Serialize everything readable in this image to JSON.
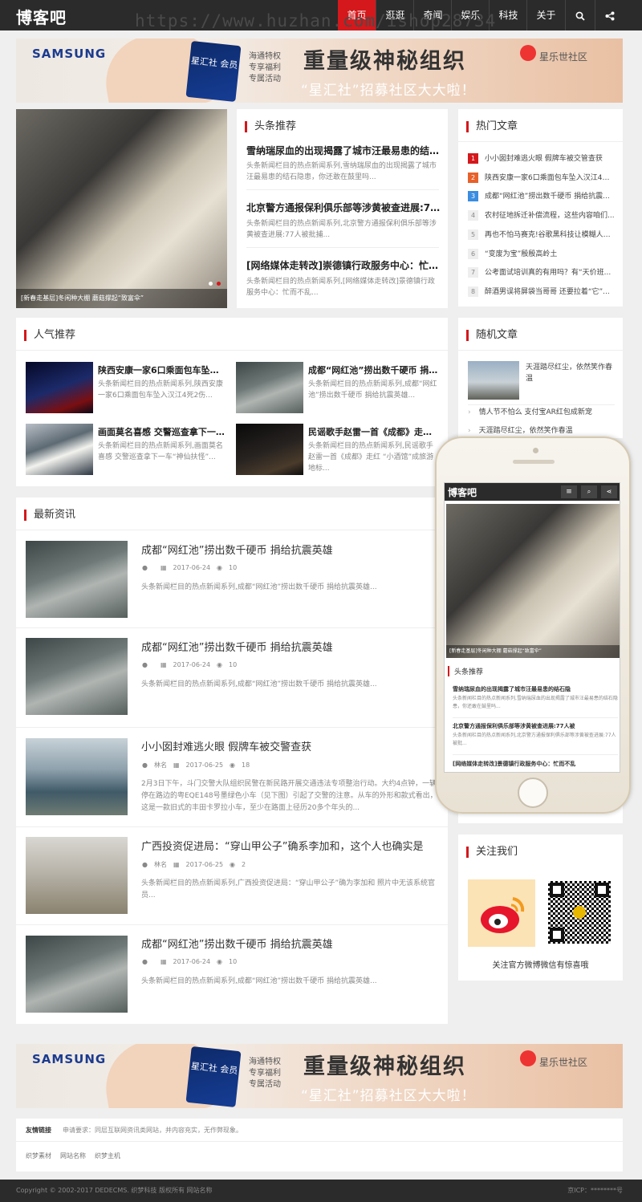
{
  "site": {
    "logo": "博客吧"
  },
  "nav": {
    "items": [
      "首页",
      "逛逛",
      "奇闻",
      "娱乐",
      "科技",
      "关于"
    ],
    "active": "首页"
  },
  "watermark": "https://www.huzhan.com/ishop28734",
  "banner": {
    "brand": "SAMSUNG",
    "card": "星汇社 会员",
    "perks": [
      "海通特权",
      "专享福利",
      "专属活动"
    ],
    "headline": "重量级神秘组织",
    "subline": "“星汇社”招募社区大大啦！",
    "club": "星乐世社区"
  },
  "featured": {
    "caption": "[新春走基层]冬闲种大棚 蘑菇撑起“致富伞”"
  },
  "headlines": {
    "title": "头条推荐",
    "items": [
      {
        "title": "雪纳瑞尿血的出现揭露了城市汪最易患的结石...",
        "desc": "头条新闻栏目的热点新闻系列,雪纳瑞尿血的出现揭露了城市汪最易患的结石隐患，你还敢在鼓里吗..."
      },
      {
        "title": "北京警方通报保利俱乐部等涉黄被查进展:77...",
        "desc": "头条新闻栏目的热点新闻系列,北京警方通报保利俱乐部等涉黄被查进展:77人被批捕..."
      },
      {
        "title": "[网络媒体走转改]崇德镇行政服务中心：忙而...",
        "desc": "头条新闻栏目的热点新闻系列,[网络媒体走转改]景德镇行政服务中心：忙而不乱..."
      }
    ]
  },
  "hot": {
    "title": "热门文章",
    "items": [
      "小小囡封难逃火眼 假牌车被交管查获",
      "陕西安康一家6口乘面包车坠入汉江4死...",
      "成都“网红池”捞出数千硬币 捐给抗震...",
      "农村征地拆迁补偿流程，这些内容咱们...",
      "再也不怕马赛克!谷歌黑科技让模糊人脸...",
      "“变废为宝”殷殷高岭土",
      "公考面试培训真的有用吗？有“天价班...",
      "醉酒男误将屏袋当哥哥 还要拉着“它”..."
    ]
  },
  "popular": {
    "title": "人气推荐",
    "items": [
      {
        "title": "陕西安康一家6口乘面包车坠入汉...",
        "desc": "头条新闻栏目的热点新闻系列,陕西安康一家6口乘面包车坠入汉江4死2伤..."
      },
      {
        "title": "成都“网红池”捞出数千硬币 捐给...",
        "desc": "头条新闻栏目的热点新闻系列,成都“网红池”捞出数千硬币 捐给抗震英雄..."
      },
      {
        "title": "画面莫名喜感 交警巡查拿下一车“...",
        "desc": "头条新闻栏目的热点新闻系列,画面莫名喜感 交警巡查拿下一车“神仙扶怪”..."
      },
      {
        "title": "民谣歌手赵雷一首《成都》走红 “...",
        "desc": "头条新闻栏目的热点新闻系列,民谣歌手赵雷一首《成都》走红 “小酒馆”成旅游地标..."
      }
    ]
  },
  "random": {
    "title": "随机文章",
    "top": "天涯踏尽红尘，依然笑作春温",
    "items": [
      "情人节不怕么 支付宝AR红包成新宠",
      "天涯踏尽红尘，依然笑作春温"
    ]
  },
  "latest": {
    "title": "最新资讯",
    "items": [
      {
        "title": "成都“网红池”捞出数千硬币 捐给抗震英雄",
        "author": "",
        "date": "2017-06-24",
        "views": "10",
        "desc": "头条新闻栏目的热点新闻系列,成都“网红池”捞出数千硬币 捐给抗震英雄..."
      },
      {
        "title": "成都“网红池”捞出数千硬币 捐给抗震英雄",
        "author": "",
        "date": "2017-06-24",
        "views": "10",
        "desc": "头条新闻栏目的热点新闻系列,成都“网红池”捞出数千硬币 捐给抗震英雄..."
      },
      {
        "title": "小小囡封难逃火眼 假牌车被交警查获",
        "author": "林名",
        "date": "2017-06-25",
        "views": "18",
        "desc": "2月3日下午，斗门交警大队组织民警在新民路开展交通违法专项整治行动。大约4点钟，一辆停在路边的粤EQE148号墨绿色小车（见下图）引起了交警的注意。从车的外形和款式看出，这是一款旧式的丰田卡罗拉小车，至少在路面上径历20多个年头的..."
      },
      {
        "title": "广西投资促进局：“穿山甲公子”确系李加和，这个人也确实是",
        "author": "林名",
        "date": "2017-06-25",
        "views": "2",
        "desc": "头条新闻栏目的热点新闻系列,广西投资促进局：“穿山甲公子”确为李加和 照片中无该系统官员..."
      },
      {
        "title": "成都“网红池”捞出数千硬币 捐给抗震英雄",
        "author": "",
        "date": "2017-06-24",
        "views": "10",
        "desc": "头条新闻栏目的热点新闻系列,成都“网红池”捞出数千硬币 捐给抗震英雄..."
      }
    ]
  },
  "follow": {
    "title": "关注我们",
    "caption": "关注官方微博微信有惊喜哦"
  },
  "links": {
    "label": "友情链接",
    "note": "申请要求：同层互联网资讯类网站，并内容充实，无作弊现象。",
    "items": [
      "织梦素材",
      "网站名称",
      "织梦主机"
    ]
  },
  "footer": {
    "copyright": "Copyright © 2002-2017 DEDECMS. 织梦科技 版权所有 网站名称",
    "icp": "京ICP：********号"
  },
  "phone": {
    "logo": "博客吧",
    "caption": "[新春走基层]冬闲种大棚 蘑菇撑起“致富伞”",
    "section": "头条推荐",
    "items": [
      {
        "title": "雪纳瑞尿血的出现揭露了城市汪最易患的结石隐",
        "desc": "头条新闻栏目的热点新闻系列,雪纳瑞尿血的出现揭露了城市汪最易患的结石隐患，你还敢在鼓里吗..."
      },
      {
        "title": "北京警方通报保利俱乐部等涉黄被查进展:77人被",
        "desc": "头条新闻栏目的热点新闻系列,北京警方通报保利俱乐部等涉黄被查进展:77人被批..."
      },
      {
        "title": "[网络媒体走转改]景德镇行政服务中心：忙而不乱",
        "desc": ""
      }
    ]
  },
  "icons": {
    "search": "search-icon",
    "share": "share-icon",
    "menu": "menu-icon",
    "user": "user-icon",
    "calendar": "calendar-icon",
    "eye": "eye-icon",
    "weibo": "weibo-icon",
    "qr": "qr-code"
  },
  "colors": {
    "accent": "#d4181b",
    "nav": "#2b2b2b"
  }
}
